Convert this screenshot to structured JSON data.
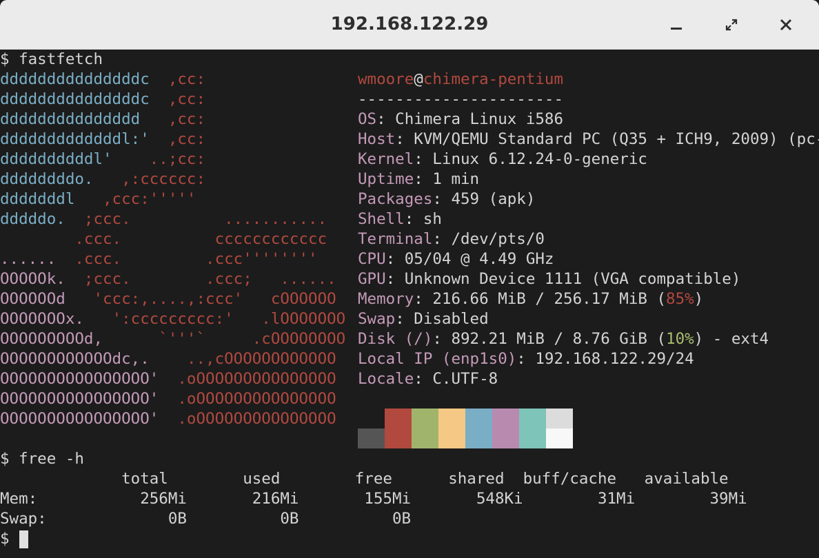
{
  "window": {
    "title": "192.168.122.29"
  },
  "terminal": {
    "prompt1": "$ fastfetch",
    "logo": [
      [
        "dddddddddddddddc  ",
        ",cc:"
      ],
      [
        "dddddddddddddddc  ",
        ",cc:"
      ],
      [
        "ddddddddddddddd   ",
        ",cc:"
      ],
      [
        "dddddddddddddl:'  ",
        ",cc:"
      ],
      [
        "ddddddddddl'    ",
        "..;cc:"
      ],
      [
        "ddddddddo.   ",
        ",:cccccc:"
      ],
      [
        "dddddddl   ",
        ",ccc:'''''"
      ],
      [
        "dddddo.  ",
        ";ccc.          ..........."
      ],
      [
        "        ",
        ".ccc.          cccccccccccc"
      ],
      [
        "......  ",
        ".ccc.         .ccc''''''''"
      ],
      [
        "OOOOOk.  ",
        ";ccc.        .ccc;   ......"
      ],
      [
        "OOOOOOd   ",
        "'ccc:,....,:ccc'   cOOOOOO"
      ],
      [
        "OOOOOOOx.   ",
        "':ccccccccc:'   .lOOOOOOO"
      ],
      [
        "OOOOOOOOOd,      ",
        "`'''`     .cOOOOOOOO"
      ],
      [
        "OOOOOOOOOOOOdc,.    ",
        "..,cOOOOOOOOOOOO"
      ],
      [
        "OOOOOOOOOOOOOOOO'  ",
        ".oOOOOOOOOOOOOOOO"
      ],
      [
        "OOOOOOOOOOOOOOOO'  ",
        ".oOOOOOOOOOOOOOOO"
      ],
      [
        "OOOOOOOOOOOOOOOO'  ",
        ".oOOOOOOOOOOOOOOO"
      ]
    ],
    "user": "wmoore",
    "at": "@",
    "host": "chimera-pentium",
    "separator": "----------------------",
    "info": {
      "os": {
        "key": "OS",
        "value": " Chimera Linux i586"
      },
      "host": {
        "key": "Host",
        "value": " KVM/QEMU Standard PC (Q35 + ICH9, 2009) (pc-)"
      },
      "kernel": {
        "key": "Kernel",
        "value": " Linux 6.12.24-0-generic"
      },
      "uptime": {
        "key": "Uptime",
        "value": " 1 min"
      },
      "packages": {
        "key": "Packages",
        "value": " 459 (apk)"
      },
      "shell": {
        "key": "Shell",
        "value": " sh"
      },
      "terminal": {
        "key": "Terminal",
        "value": " /dev/pts/0"
      },
      "cpu": {
        "key": "CPU",
        "value": " 05/04 @ 4.49 GHz"
      },
      "gpu": {
        "key": "GPU",
        "value": " Unknown Device 1111 (VGA compatible)"
      },
      "memory": {
        "key": "Memory",
        "value_pre": " 216.66 MiB / 256.17 MiB (",
        "percent": "85%",
        "value_post": ")"
      },
      "swap": {
        "key": "Swap",
        "value": " Disabled"
      },
      "disk": {
        "key": "Disk (/)",
        "value_pre": " 892.21 MiB / 8.76 GiB (",
        "percent": "10%",
        "value_post": ") - ext4"
      },
      "localip": {
        "key": "Local IP (enp1s0)",
        "value": " 192.168.122.29/24"
      },
      "locale": {
        "key": "Locale",
        "value": " C.UTF-8"
      }
    },
    "colors": {
      "logo_blue": "#7aaec5",
      "logo_red": "#b1493f",
      "logo_magenta": "#c49ab8",
      "palette_normal": [
        "#1c1c1c",
        "#b1493f",
        "#a0b56b",
        "#f5c985",
        "#7aaec5",
        "#b98ab0",
        "#7ec4b8",
        "#dcdcdc"
      ],
      "palette_bright": [
        "#555555",
        "#b1493f",
        "#a0b56b",
        "#f5c985",
        "#7aaec5",
        "#b98ab0",
        "#7ec4b8",
        "#f8f8f8"
      ]
    },
    "prompt2": "$ free -h",
    "free": {
      "header": "             total        used        free      shared  buff/cache   available",
      "mem": "Mem:           256Mi       216Mi       155Mi       548Ki        31Mi        39Mi",
      "swap": "Swap:             0B          0B          0B"
    },
    "prompt3": "$ "
  }
}
